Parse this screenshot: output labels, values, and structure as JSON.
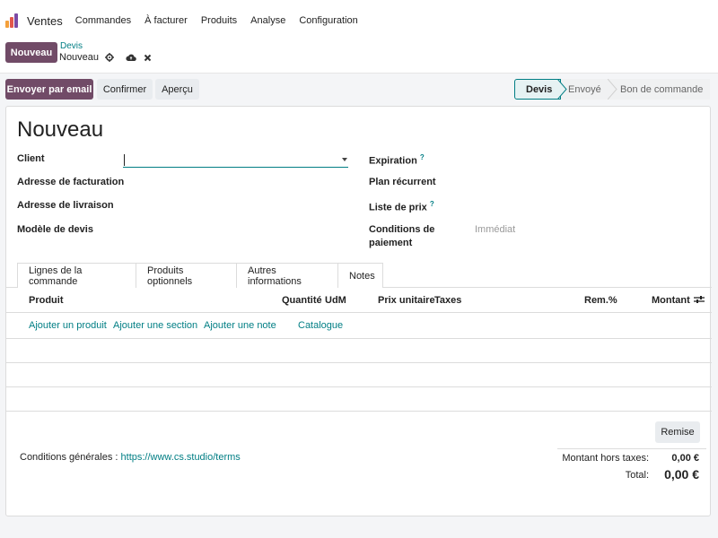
{
  "app": {
    "name": "Ventes",
    "brand_colors": [
      "#f4a03a",
      "#e2574c",
      "#7c4ba5"
    ],
    "nav": [
      "Commandes",
      "À facturer",
      "Produits",
      "Analyse",
      "Configuration"
    ]
  },
  "control": {
    "new_button": "Nouveau",
    "breadcrumb_parent": "Devis",
    "breadcrumb_current": "Nouveau",
    "icons": [
      "gear-icon",
      "cloud-upload-icon",
      "close-icon"
    ]
  },
  "actions": {
    "send_email": "Envoyer par email",
    "confirm": "Confirmer",
    "preview": "Aperçu"
  },
  "statusbar": {
    "steps": [
      "Devis",
      "Envoyé",
      "Bon de commande"
    ],
    "active": "Devis"
  },
  "form": {
    "title": "Nouveau",
    "left_fields": [
      {
        "label": "Client",
        "value": ""
      },
      {
        "label": "Adresse de facturation",
        "value": ""
      },
      {
        "label": "Adresse de livraison",
        "value": ""
      },
      {
        "label": "Modèle de devis",
        "value": ""
      }
    ],
    "right_fields": [
      {
        "label": "Expiration",
        "help": "?",
        "value": ""
      },
      {
        "label": "Plan récurrent",
        "value": ""
      },
      {
        "label": "Liste de prix",
        "help": "?",
        "value": ""
      },
      {
        "label_line1": "Conditions de",
        "label_line2": "paiement",
        "value": "Immédiat"
      }
    ]
  },
  "tabs": [
    "Lignes de la commande",
    "Produits optionnels",
    "Autres informations",
    "Notes"
  ],
  "active_tab": "Lignes de la commande",
  "table": {
    "headers": [
      "Produit",
      "Quantité",
      "UdM",
      "Prix unitaire",
      "Taxes",
      "Rem.%",
      "Montant"
    ],
    "add_links": [
      "Ajouter un produit",
      "Ajouter une section",
      "Ajouter une note",
      "Catalogue"
    ]
  },
  "footer": {
    "discount_button": "Remise",
    "terms_label": "Conditions générales :",
    "terms_link": "https://www.cs.studio/terms",
    "untaxed_label": "Montant hors taxes:",
    "untaxed_value": "0,00 €",
    "total_label": "Total:",
    "total_value": "0,00 €"
  },
  "colors": {
    "primary": "#714b67",
    "link": "#017e84"
  }
}
